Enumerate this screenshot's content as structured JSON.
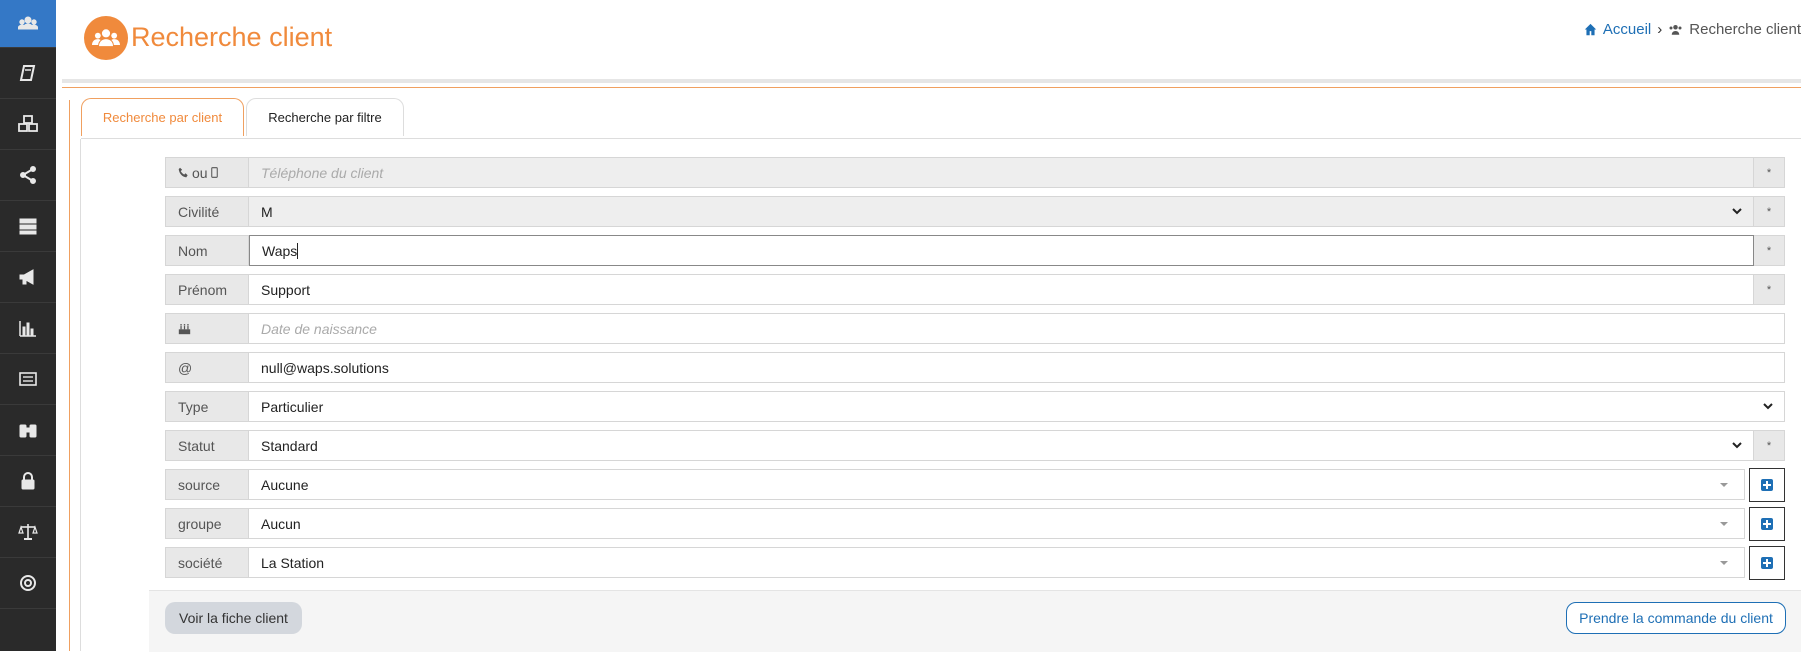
{
  "header": {
    "title": "Recherche client",
    "breadcrumb": {
      "home": "Accueil",
      "current": "Recherche client"
    }
  },
  "sidebar": {
    "items": [
      {
        "icon": "users-icon"
      },
      {
        "icon": "book-icon"
      },
      {
        "icon": "cubes-icon"
      },
      {
        "icon": "share-icon"
      },
      {
        "icon": "server-icon"
      },
      {
        "icon": "bullhorn-icon"
      },
      {
        "icon": "bar-chart-icon"
      },
      {
        "icon": "list-icon"
      },
      {
        "icon": "binoculars-icon"
      },
      {
        "icon": "lock-icon"
      },
      {
        "icon": "balance-scale-icon"
      },
      {
        "icon": "life-ring-icon"
      }
    ]
  },
  "tabs": {
    "client": "Recherche par client",
    "filter": "Recherche par filtre"
  },
  "form": {
    "phone": {
      "label": "ou",
      "placeholder": "Téléphone du client",
      "suffix": "*"
    },
    "civility": {
      "label": "Civilité",
      "value": "M",
      "suffix": "*"
    },
    "nom": {
      "label": "Nom",
      "value": "Waps",
      "suffix": "*"
    },
    "prenom": {
      "label": "Prénom",
      "value": "Support",
      "suffix": "*"
    },
    "birth": {
      "placeholder": "Date de naissance"
    },
    "email": {
      "label": "@",
      "value": "null@waps.solutions"
    },
    "type": {
      "label": "Type",
      "value": "Particulier"
    },
    "statut": {
      "label": "Statut",
      "value": "Standard",
      "suffix": "*"
    },
    "source": {
      "label": "source",
      "value": "Aucune"
    },
    "groupe": {
      "label": "groupe",
      "value": "Aucun"
    },
    "societe": {
      "label": "société",
      "value": "La Station"
    }
  },
  "buttons": {
    "view": "Voir la fiche client",
    "order": "Prendre la commande du client"
  },
  "colors": {
    "accent": "#f08a3c",
    "link": "#1e6fb5",
    "sidebar": "#2a2a2a",
    "sidebar_active": "#3478c6"
  }
}
